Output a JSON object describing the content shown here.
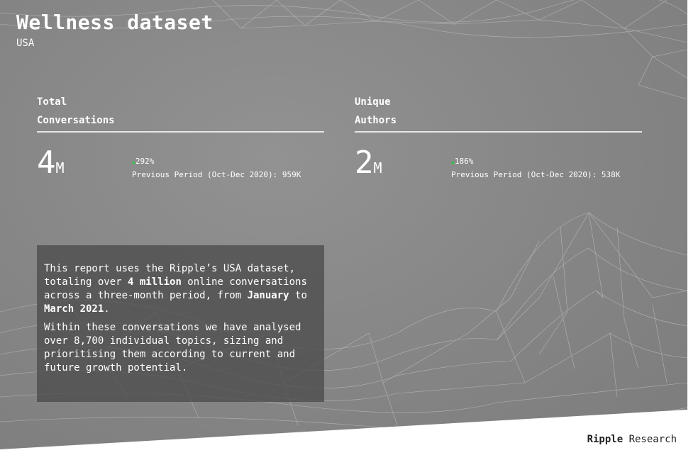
{
  "header": {
    "title": "Wellness dataset",
    "subtitle": "USA"
  },
  "kpis": [
    {
      "label_line1": "Total",
      "label_line2": "Conversations",
      "value": "4",
      "unit": "M",
      "change": "292%",
      "previous": "Previous Period (Oct-Dec 2020): 959K"
    },
    {
      "label_line1": "Unique",
      "label_line2": "Authors",
      "value": "2",
      "unit": "M",
      "change": "186%",
      "previous": "Previous Period (Oct-Dec 2020): 538K"
    }
  ],
  "description": {
    "p1_a": "This report uses the Ripple’s USA dataset, totaling over ",
    "p1_b": "4 million",
    "p1_c": " online conversations across a three-month period, from ",
    "p1_d": "January",
    "p1_e": " to ",
    "p1_f": "March 2021",
    "p1_g": ".",
    "p2": "Within these conversations we have analysed over 8,700 individual topics, sizing and prioritising them according to current and future growth potential."
  },
  "footer": {
    "brand": "Ripple",
    "suffix": " Research"
  },
  "colors": {
    "background": "#858585",
    "up_arrow": "#2ec44a",
    "text_box": "#4b4b4b"
  },
  "icons": {
    "change_indicator": "triangle-up-icon"
  }
}
